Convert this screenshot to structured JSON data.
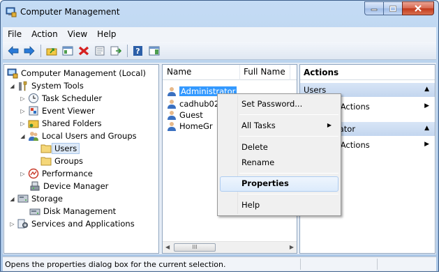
{
  "window": {
    "title": "Computer Management"
  },
  "menubar": {
    "items": [
      "File",
      "Action",
      "View",
      "Help"
    ]
  },
  "toolbar": {
    "icons": [
      "back-arrow-icon",
      "forward-arrow-icon",
      "up-folder-icon",
      "show-hide-tree-icon",
      "delete-icon",
      "properties-icon",
      "export-list-icon",
      "help-icon",
      "show-action-pane-icon"
    ]
  },
  "tree": {
    "items": [
      {
        "label": "Computer Management (Local)",
        "icon": "computer-management-icon"
      },
      {
        "label": "System Tools",
        "icon": "system-tools-icon",
        "expander": "◢"
      },
      {
        "label": "Task Scheduler",
        "icon": "task-scheduler-icon",
        "expander": "▷"
      },
      {
        "label": "Event Viewer",
        "icon": "event-viewer-icon",
        "expander": "▷"
      },
      {
        "label": "Shared Folders",
        "icon": "shared-folders-icon",
        "expander": "▷"
      },
      {
        "label": "Local Users and Groups",
        "icon": "users-groups-icon",
        "expander": "◢"
      },
      {
        "label": "Users",
        "icon": "folder-icon"
      },
      {
        "label": "Groups",
        "icon": "folder-icon"
      },
      {
        "label": "Performance",
        "icon": "performance-icon",
        "expander": "▷"
      },
      {
        "label": "Device Manager",
        "icon": "device-manager-icon"
      },
      {
        "label": "Storage",
        "icon": "storage-icon",
        "expander": "◢"
      },
      {
        "label": "Disk Management",
        "icon": "disk-management-icon"
      },
      {
        "label": "Services and Applications",
        "icon": "services-icon",
        "expander": "▷"
      }
    ]
  },
  "list": {
    "columns": [
      "Name",
      "Full Name"
    ],
    "rows": [
      {
        "name": "Administrator",
        "selected": true
      },
      {
        "name": "cadhub02"
      },
      {
        "name": "Guest"
      },
      {
        "name": "HomeGr"
      }
    ],
    "scroll_thumb": "III"
  },
  "actions": {
    "header": "Actions",
    "sections": [
      {
        "title": "Users",
        "item": "More Actions"
      },
      {
        "title": "Administrator",
        "item": "More Actions"
      }
    ],
    "visible": {
      "section1": "Users",
      "item1": "e Actions",
      "section2": "rator",
      "item2": "e Actions"
    }
  },
  "context_menu": {
    "items": [
      "Set Password...",
      "All Tasks",
      "Delete",
      "Rename",
      "Properties",
      "Help"
    ],
    "highlighted": "Properties"
  },
  "status": {
    "text": "Opens the properties dialog box for the current selection."
  }
}
